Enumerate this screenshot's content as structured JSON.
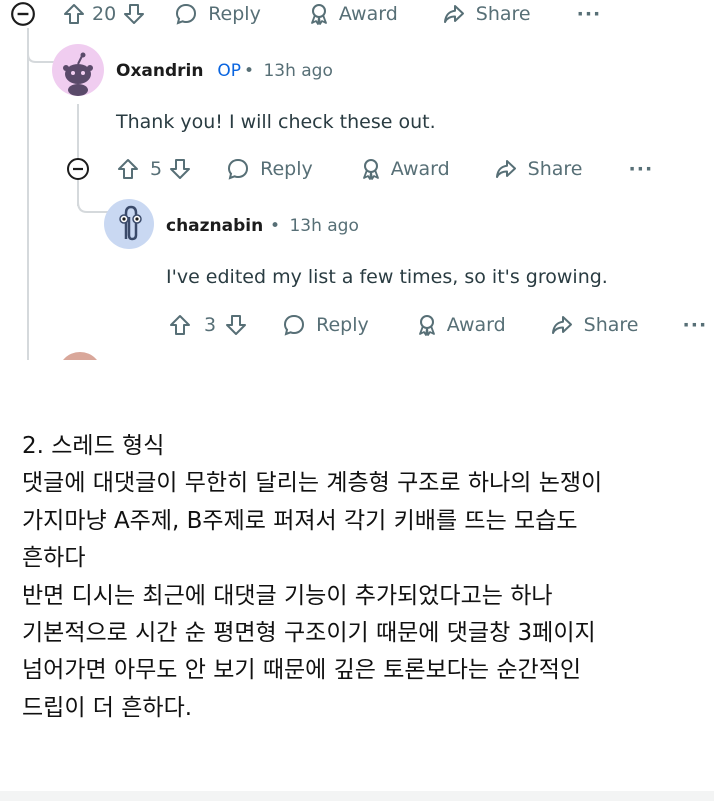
{
  "thread": {
    "top_actions": {
      "score": "20",
      "reply": "Reply",
      "award": "Award",
      "share": "Share",
      "more": "···"
    },
    "comment1": {
      "username": "Oxandrin",
      "op_badge": "OP",
      "dot": "•",
      "time": "13h ago",
      "text": "Thank you! I will check these out.",
      "actions": {
        "score": "5",
        "reply": "Reply",
        "award": "Award",
        "share": "Share",
        "more": "···"
      }
    },
    "comment2": {
      "username": "chaznabin",
      "dot": "•",
      "time": "13h ago",
      "text": "I've edited my list a few times, so it's growing.",
      "actions": {
        "score": "3",
        "reply": "Reply",
        "award": "Award",
        "share": "Share",
        "more": "···"
      }
    }
  },
  "article": {
    "lines": [
      "2. 스레드 형식",
      "댓글에 대댓글이 무한히 달리는 계층형 구조로 하나의 논쟁이",
      "가지마냥 A주제, B주제로 퍼져서 각기 키배를 뜨는 모습도",
      "흔하다",
      "반면 디시는 최근에 대댓글 기능이 추가되었다고는 하나",
      "기본적으로 시간 순 평면형 구조이기 때문에 댓글창 3페이지",
      "넘어가면 아무도 안 보기 때문에 깊은 토론보다는 순간적인",
      "드립이 더 흔하다."
    ]
  },
  "colors": {
    "meta": "#576f76",
    "op": "#0a65e0",
    "thread_line": "#d5d9dc",
    "avatar1": "#ff4500",
    "avatar2_bg": "#c9d8f2"
  }
}
